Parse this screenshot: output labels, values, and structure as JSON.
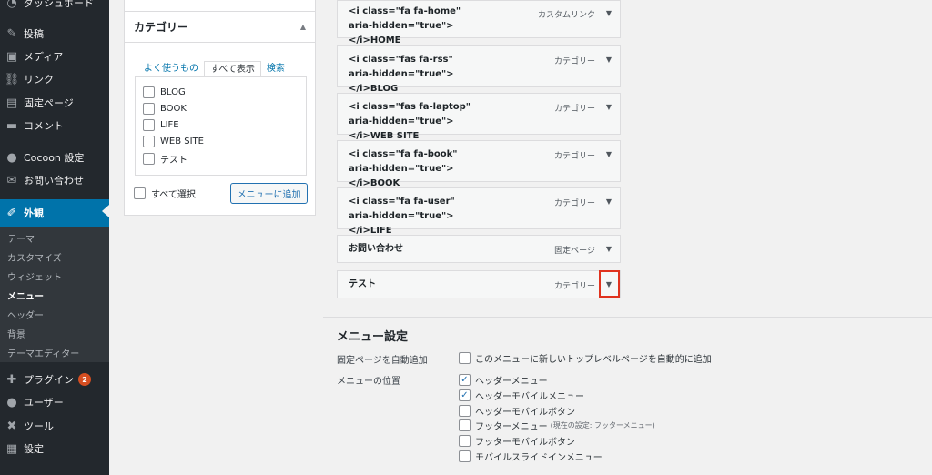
{
  "sidebar": {
    "items": [
      {
        "key": "dashboard",
        "label": "ダッシュボード",
        "icon": "dashboard-icon",
        "glyph": "◔"
      },
      {
        "key": "posts",
        "label": "投稿",
        "icon": "pin-icon",
        "glyph": "✎"
      },
      {
        "key": "media",
        "label": "メディア",
        "icon": "media-icon",
        "glyph": "▣"
      },
      {
        "key": "links",
        "label": "リンク",
        "icon": "link-icon",
        "glyph": "⛓"
      },
      {
        "key": "pages",
        "label": "固定ページ",
        "icon": "page-icon",
        "glyph": "▤"
      },
      {
        "key": "comments",
        "label": "コメント",
        "icon": "comment-icon",
        "glyph": "▬"
      },
      {
        "key": "cocoon",
        "label": "Cocoon 設定",
        "icon": "circle-icon",
        "glyph": "●"
      },
      {
        "key": "contact",
        "label": "お問い合わせ",
        "icon": "mail-icon",
        "glyph": "✉"
      },
      {
        "key": "appearance",
        "label": "外観",
        "icon": "brush-icon",
        "glyph": "✐"
      }
    ],
    "submenu": [
      "テーマ",
      "カスタマイズ",
      "ウィジェット",
      "メニュー",
      "ヘッダー",
      "背景",
      "テーマエディター"
    ],
    "bottom_items": [
      {
        "key": "plugins",
        "label": "プラグイン",
        "icon": "plugin-icon",
        "glyph": "✚",
        "badge": "2"
      },
      {
        "key": "users",
        "label": "ユーザー",
        "icon": "user-icon",
        "glyph": "●"
      },
      {
        "key": "tools",
        "label": "ツール",
        "icon": "wrench-icon",
        "glyph": "✖"
      },
      {
        "key": "settings",
        "label": "設定",
        "icon": "settings-icon",
        "glyph": "▦"
      }
    ],
    "active_color": "#0073aa"
  },
  "category_panel": {
    "title": "カテゴリー",
    "tabs": [
      "よく使うもの",
      "すべて表示",
      "検索"
    ],
    "categories": [
      "BLOG",
      "BOOK",
      "LIFE",
      "WEB SITE",
      "テスト"
    ],
    "select_all": "すべて選択",
    "add_button": "メニューに追加"
  },
  "menu_items": [
    {
      "title": "<i class=\"fa fa-home\" aria-hidden=\"true\"></i>HOME",
      "type": "カスタムリンク"
    },
    {
      "title": "<i class=\"fas fa-rss\" aria-hidden=\"true\"></i>BLOG",
      "type": "カテゴリー"
    },
    {
      "title": "<i class=\"fas fa-laptop\" aria-hidden=\"true\"></i>WEB SITE",
      "type": "カテゴリー"
    },
    {
      "title": "<i class=\"fa fa-book\" aria-hidden=\"true\"></i>BOOK",
      "type": "カテゴリー"
    },
    {
      "title": "<i class=\"fa fa-user\" aria-hidden=\"true\"></i>LIFE",
      "type": "カテゴリー"
    },
    {
      "title": "お問い合わせ",
      "type": "固定ページ"
    },
    {
      "title": "テスト",
      "type": "カテゴリー"
    }
  ],
  "menu_settings": {
    "title": "メニュー設定",
    "auto_add_label": "固定ページを自動追加",
    "auto_add_option": "このメニューに新しいトップレベルページを自動的に追加",
    "location_label": "メニューの位置",
    "locations": [
      {
        "label": "ヘッダーメニュー",
        "checked": true,
        "note": ""
      },
      {
        "label": "ヘッダーモバイルメニュー",
        "checked": true,
        "note": ""
      },
      {
        "label": "ヘッダーモバイルボタン",
        "checked": false,
        "note": ""
      },
      {
        "label": "フッターメニュー",
        "checked": false,
        "note": "(現在の設定: フッターメニュー)"
      },
      {
        "label": "フッターモバイルボタン",
        "checked": false,
        "note": ""
      },
      {
        "label": "モバイルスライドインメニュー",
        "checked": false,
        "note": ""
      }
    ]
  },
  "highlight_color": "#e0331f"
}
